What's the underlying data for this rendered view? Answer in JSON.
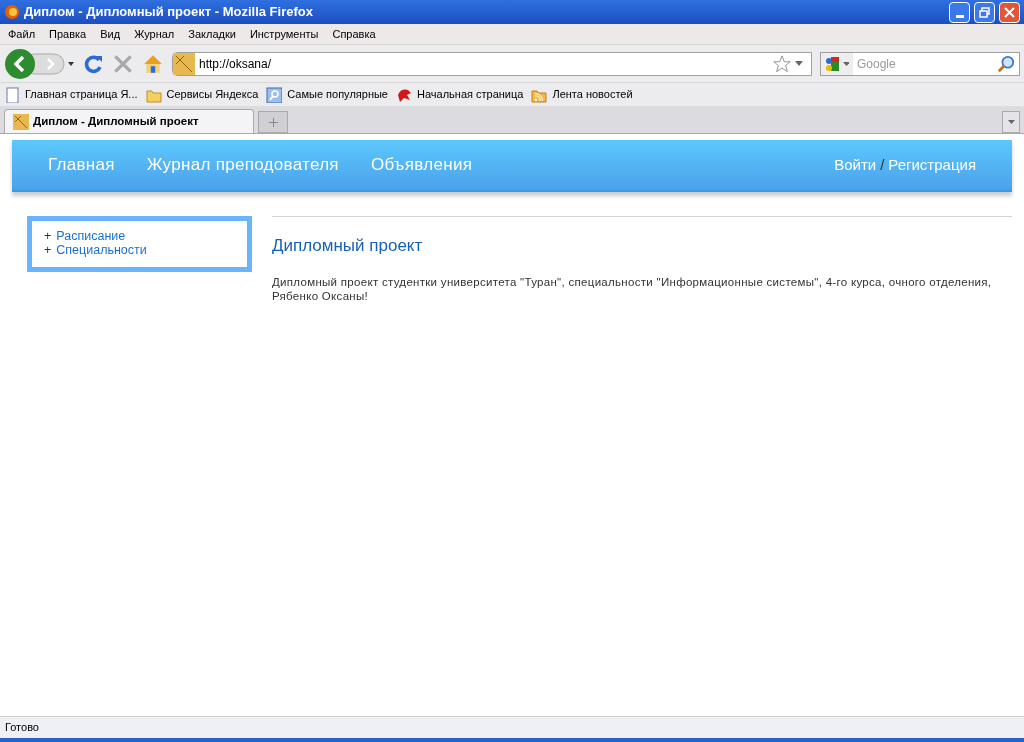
{
  "window": {
    "title": "Диплом - Дипломный проект - Mozilla Firefox"
  },
  "menu": [
    "Файл",
    "Правка",
    "Вид",
    "Журнал",
    "Закладки",
    "Инструменты",
    "Справка"
  ],
  "address_bar": {
    "value": "http://oksana/"
  },
  "search": {
    "placeholder": "Google"
  },
  "bookmarks": [
    "Главная страница Я...",
    "Сервисы Яндекса",
    "Самые популярные",
    "Начальная страница",
    "Лента новостей"
  ],
  "tabs": [
    {
      "label": "Диплом - Дипломный проект",
      "selected": true
    }
  ],
  "page": {
    "nav": [
      "Главная",
      "Журнал преподователя",
      "Объявления"
    ],
    "auth": {
      "login": "Войти",
      "separator": "/",
      "register": "Регистрация"
    },
    "sidebar": {
      "items": [
        {
          "marker": "+",
          "label": "Расписание"
        },
        {
          "marker": "+",
          "label": "Специальности"
        }
      ]
    },
    "heading": "Дипломный проект",
    "text": "Дипломный проект студентки университета \"Туран\", специальности \"Информационные системы\", 4-го курса, очного отделения, Рябенко Оксаны!"
  },
  "status_bar": "Готово"
}
